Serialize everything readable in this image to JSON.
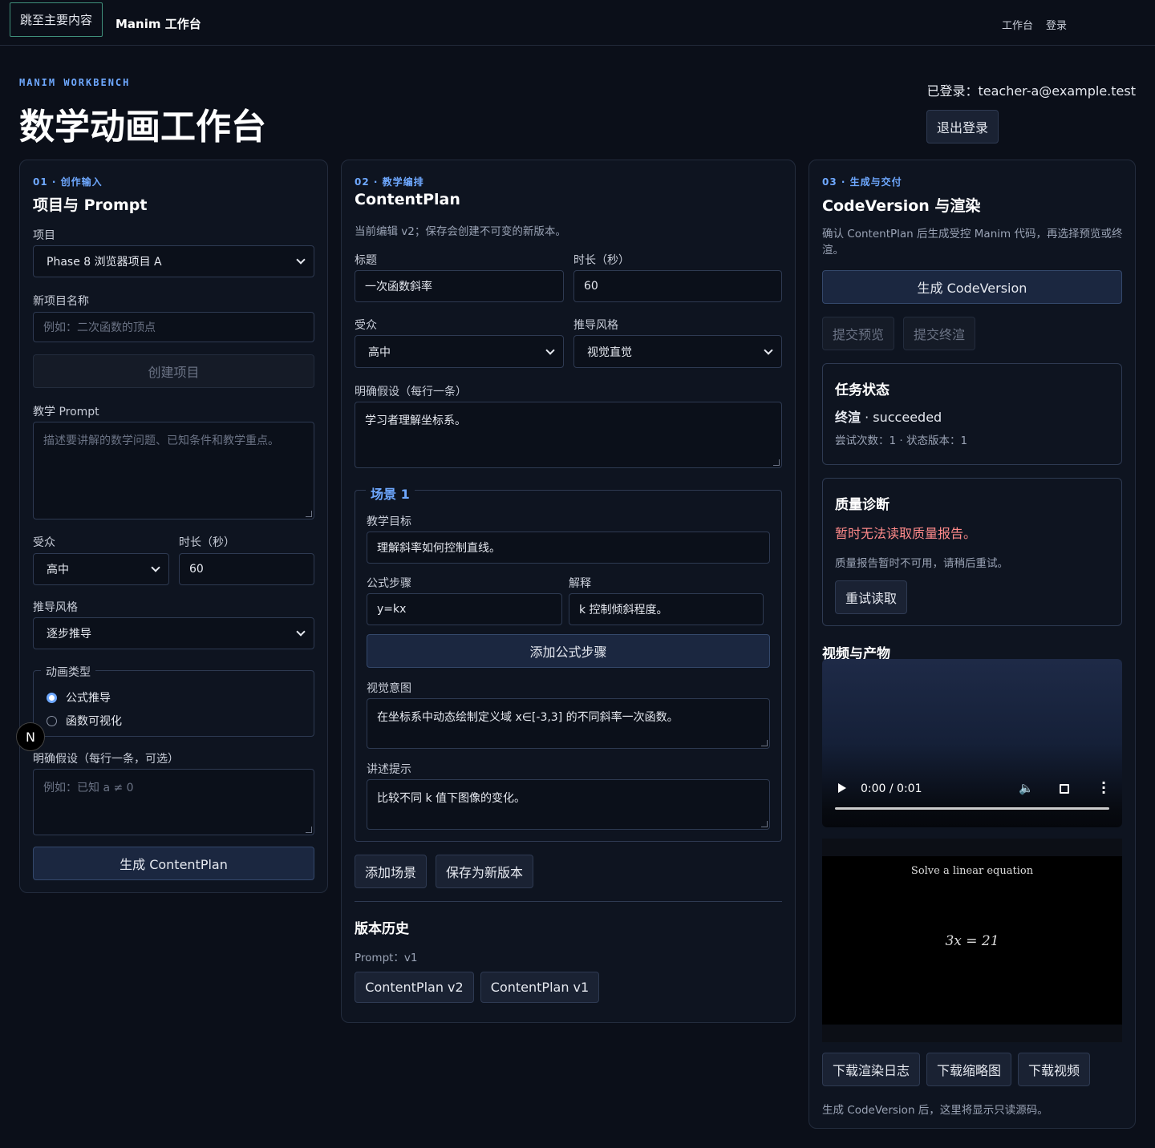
{
  "topbar": {
    "skip_link": "跳至主要内容",
    "brand": "Manim 工作台",
    "nav": [
      "工作台",
      "登录"
    ]
  },
  "header": {
    "eyebrow": "MANIM WORKBENCH",
    "title": "数学动画工作台",
    "user_line": "已登录：teacher-a@example.test",
    "logout": "退出登录"
  },
  "panel1": {
    "step": "01 · 创作输入",
    "title": "项目与 Prompt",
    "project_label": "项目",
    "project_value": "Phase 8 浏览器项目 A",
    "new_project_label": "新项目名称",
    "new_project_placeholder": "例如：二次函数的顶点",
    "create_project": "创建项目",
    "prompt_label": "教学 Prompt",
    "prompt_placeholder": "描述要讲解的数学问题、已知条件和教学重点。",
    "audience_label": "受众",
    "audience_value": "高中",
    "duration_label": "时长（秒）",
    "duration_value": "60",
    "style_label": "推导风格",
    "style_value": "逐步推导",
    "anim_legend": "动画类型",
    "anim_options": [
      "公式推导",
      "函数可视化"
    ],
    "anim_selected": "公式推导",
    "assumptions_label": "明确假设（每行一条，可选）",
    "assumptions_placeholder": "例如：已知 a ≠ 0",
    "generate": "生成 ContentPlan"
  },
  "panel2": {
    "step": "02 · 教学编排",
    "title": "ContentPlan",
    "subtitle": "当前编辑 v2；保存会创建不可变的新版本。",
    "title_label": "标题",
    "title_value": "一次函数斜率",
    "duration_label": "时长（秒）",
    "duration_value": "60",
    "audience_label": "受众",
    "audience_value": "高中",
    "style_label": "推导风格",
    "style_value": "视觉直觉",
    "assumptions_label": "明确假设（每行一条）",
    "assumptions_value": "学习者理解坐标系。",
    "scene": {
      "legend": "场景 1",
      "goal_label": "教学目标",
      "goal_value": "理解斜率如何控制直线。",
      "formula_label": "公式步骤",
      "formula_value": "y=kx",
      "explain_label": "解释",
      "explain_value": "k 控制倾斜程度。",
      "add_formula": "添加公式步骤",
      "visual_label": "视觉意图",
      "visual_value": "在坐标系中动态绘制定义域 x∈[-3,3] 的不同斜率一次函数。",
      "narration_label": "讲述提示",
      "narration_value": "比较不同 k 值下图像的变化。"
    },
    "add_scene": "添加场景",
    "save_version": "保存为新版本",
    "history_title": "版本历史",
    "history_prompt": "Prompt：v1",
    "versions": [
      "ContentPlan v2",
      "ContentPlan v1"
    ]
  },
  "panel3": {
    "step": "03 · 生成与交付",
    "title": "CodeVersion 与渲染",
    "subtitle": "确认 ContentPlan 后生成受控 Manim 代码，再选择预览或终渲。",
    "generate_code": "生成 CodeVersion",
    "submit_preview": "提交预览",
    "submit_final": "提交终渲",
    "task": {
      "title": "任务状态",
      "kind": "终渲",
      "status": "succeeded",
      "meta": "尝试次数：1 · 状态版本：1"
    },
    "quality": {
      "title": "质量诊断",
      "error": "暂时无法读取质量报告。",
      "note": "质量报告暂时不可用，请稍后重试。",
      "retry": "重试读取"
    },
    "media_title": "视频与产物",
    "video_time": "0:00 / 0:01",
    "thumb_title": "Solve a linear equation",
    "thumb_eq": "3x = 21",
    "downloads": [
      "下载渲染日志",
      "下载缩略图",
      "下载视频"
    ],
    "footer_note": "生成 CodeVersion 后，这里将显示只读源码。",
    "error_color": "#ff8a8a"
  },
  "floating": {
    "badge": "N"
  }
}
